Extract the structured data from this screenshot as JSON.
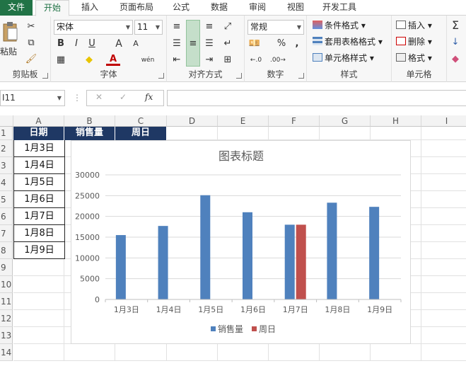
{
  "tabs": [
    "文件",
    "开始",
    "插入",
    "页面布局",
    "公式",
    "数据",
    "审阅",
    "视图",
    "开发工具"
  ],
  "ribbon": {
    "clipboard": {
      "paste": "粘贴",
      "label": "剪贴板"
    },
    "font": {
      "name": "宋体",
      "size": "11",
      "label": "字体",
      "bold": "B",
      "italic": "I",
      "underline": "U",
      "grow": "A",
      "shrink": "A",
      "phonetic": "wén"
    },
    "alignment": {
      "label": "对齐方式"
    },
    "number": {
      "format": "常规",
      "label": "数字",
      "percent": "%",
      "comma": ","
    },
    "styles": {
      "conditional": "条件格式",
      "table": "套用表格格式",
      "cell": "单元格样式",
      "label": "样式"
    },
    "cells": {
      "insert": "插入",
      "delete": "删除",
      "format": "格式",
      "label": "单元格"
    },
    "editing": {
      "sum": "Σ"
    }
  },
  "formula_bar": {
    "name_box": "I11",
    "cancel": "✕",
    "enter": "✓",
    "fx": "fx",
    "value": ""
  },
  "columns": [
    "A",
    "B",
    "C",
    "D",
    "E",
    "F",
    "G",
    "H",
    "I"
  ],
  "rows": [
    "1",
    "2",
    "3",
    "4",
    "5",
    "6",
    "7",
    "8",
    "9",
    "10",
    "11",
    "12",
    "13",
    "14"
  ],
  "table": {
    "headers": [
      "日期",
      "销售量",
      "周日"
    ],
    "dates": [
      "1月3日",
      "1月4日",
      "1月5日",
      "1月6日",
      "1月7日",
      "1月8日",
      "1月9日"
    ]
  },
  "chart_data": {
    "type": "bar",
    "title": "图表标题",
    "categories": [
      "1月3日",
      "1月4日",
      "1月5日",
      "1月6日",
      "1月7日",
      "1月8日",
      "1月9日"
    ],
    "series": [
      {
        "name": "销售量",
        "color": "#4f81bd",
        "values": [
          15500,
          17700,
          25100,
          21000,
          18000,
          23300,
          22300
        ]
      },
      {
        "name": "周日",
        "color": "#c0504d",
        "values": [
          null,
          null,
          null,
          null,
          18000,
          null,
          null
        ]
      }
    ],
    "ylim": [
      0,
      30000
    ],
    "yticks": [
      0,
      5000,
      10000,
      15000,
      20000,
      25000,
      30000
    ],
    "grid": true,
    "legend": "bottom"
  }
}
